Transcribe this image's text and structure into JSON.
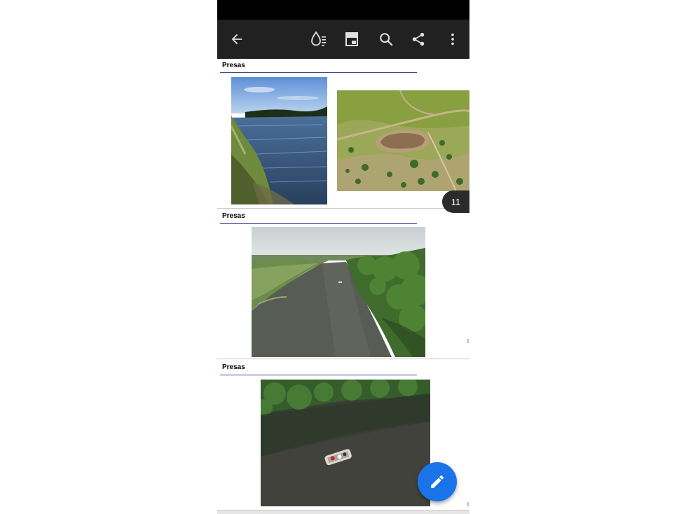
{
  "toolbar": {
    "icons": [
      "back-arrow-icon",
      "reading-mode-icon",
      "page-layout-icon",
      "search-icon",
      "share-icon",
      "more-vert-icon"
    ]
  },
  "pages": [
    {
      "title": "Presas",
      "images": [
        "river-with-grassy-bank-photo",
        "aerial-pond-in-scrubland-photo"
      ]
    },
    {
      "title": "Presas",
      "images": [
        "aerial-river-with-trees-photo"
      ]
    },
    {
      "title": "Presas",
      "images": [
        "aerial-boat-on-river-photo"
      ]
    }
  ],
  "page_indicator": "11",
  "fab": {
    "icon": "edit-pencil-icon"
  },
  "colors": {
    "toolbar_bg": "#212121",
    "status_bar_bg": "#000000",
    "fab_bg": "#1a73e8",
    "badge_bg": "#2b2b2b",
    "title_rule": "#3b4a8c"
  }
}
